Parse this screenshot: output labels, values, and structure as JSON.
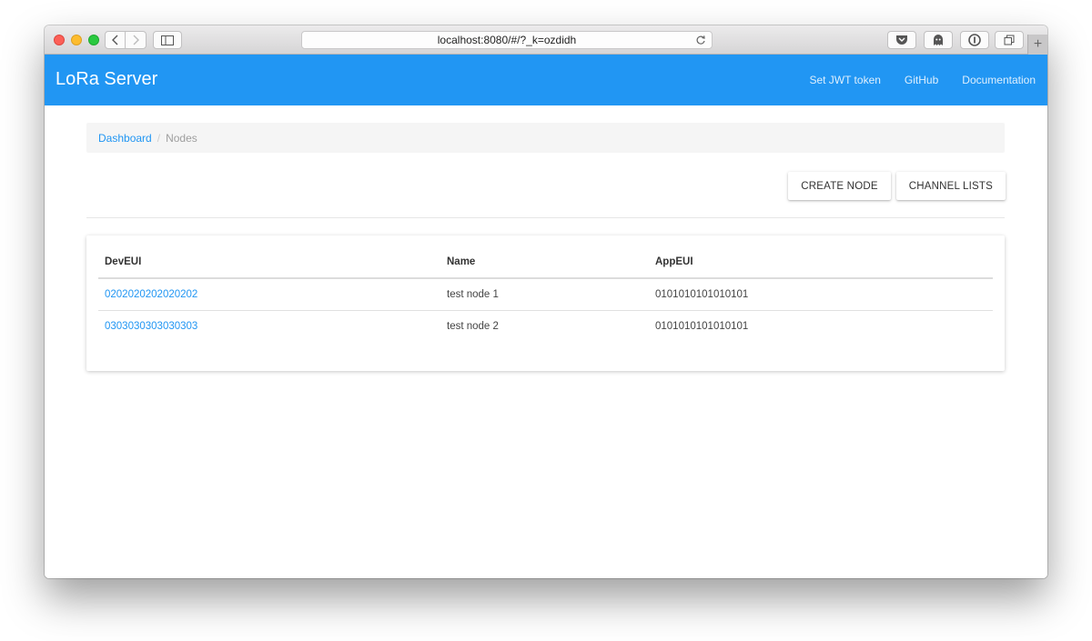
{
  "browser": {
    "address": "localhost:8080/#/?_k=ozdidh"
  },
  "app": {
    "brand": "LoRa Server",
    "nav": [
      "Set JWT token",
      "GitHub",
      "Documentation"
    ]
  },
  "breadcrumb": {
    "root": "Dashboard",
    "separator": "/",
    "current": "Nodes"
  },
  "actions": {
    "create_node": "CREATE NODE",
    "channel_lists": "CHANNEL LISTS"
  },
  "table": {
    "headers": [
      "DevEUI",
      "Name",
      "AppEUI"
    ],
    "rows": [
      [
        "0202020202020202",
        "test node 1",
        "0101010101010101"
      ],
      [
        "0303030303030303",
        "test node 2",
        "0101010101010101"
      ]
    ]
  },
  "colors": {
    "primary": "#2196f3",
    "breadcrumb_bg": "#f5f5f5"
  }
}
